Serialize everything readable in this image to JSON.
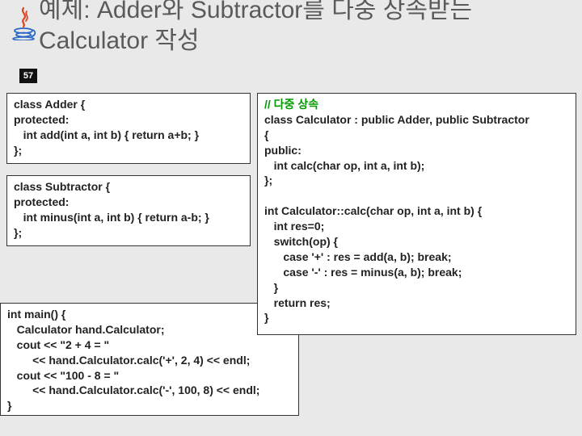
{
  "page_number": "57",
  "title": "예제: Adder와 Subtractor를 다중 상속받는\nCalculator 작성",
  "icon": "java-logo-icon",
  "code_left1": "class Adder {\nprotected:\n   int add(int a, int b) { return a+b; }\n};",
  "code_left2": "class Subtractor {\nprotected:\n   int minus(int a, int b) { return a-b; }\n};",
  "code_main": "int main() {\n   Calculator hand.Calculator;\n   cout << \"2 + 4 = \"\n        << hand.Calculator.calc('+', 2, 4) << endl;\n   cout << \"100 - 8 = \"\n        << hand.Calculator.calc('-', 100, 8) << endl;\n}",
  "code_right_comment": "// 다중 상속",
  "code_right_decl": "class Calculator : public Adder, public Subtractor",
  "code_right_body": "{\npublic:\n   int calc(char op, int a, int b);\n};\n\nint Calculator::calc(char op, int a, int b) {\n   int res=0;\n   switch(op) {\n      case '+' : res = add(a, b); break;\n      case '-' : res = minus(a, b); break;\n   }\n   return res;\n}"
}
